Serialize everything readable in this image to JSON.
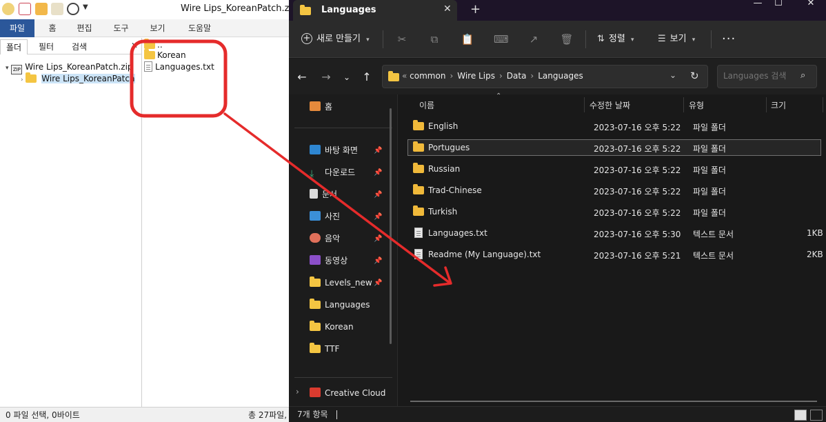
{
  "bandizip": {
    "title": "Wire Lips_KoreanPatch.zip - ",
    "ribbon_tabs": [
      "파일",
      "홈",
      "편집",
      "도구",
      "보기",
      "도움말"
    ],
    "sub_tabs": [
      "폴더",
      "필터",
      "검색"
    ],
    "tree": {
      "archive": "Wire Lips_KoreanPatch.zip",
      "folder": "Wire Lips_KoreanPatch"
    },
    "files": [
      "..",
      "Korean",
      "Languages.txt"
    ],
    "status_left": "0 파일 선택, 0바이트",
    "status_right": "총 27파일,"
  },
  "explorer": {
    "tab_title": "Languages",
    "toolbar": {
      "new_label": "새로 만들기",
      "sort_label": "정렬",
      "view_label": "보기"
    },
    "breadcrumb": [
      "common",
      "Wire Lips",
      "Data",
      "Languages"
    ],
    "search_placeholder": "Languages 검색",
    "nav": {
      "home": "홈",
      "pinned": [
        "바탕 화면",
        "다운로드",
        "문서",
        "사진",
        "음악",
        "동영상",
        "Levels_new"
      ],
      "folders": [
        "Languages",
        "Korean",
        "TTF"
      ],
      "creative_cloud": "Creative Cloud"
    },
    "columns": [
      "이름",
      "수정한 날짜",
      "유형",
      "크기"
    ],
    "rows": [
      {
        "name": "English",
        "date": "2023-07-16 오후 5:22",
        "type": "파일 폴더",
        "size": "",
        "kind": "folder"
      },
      {
        "name": "Portugues",
        "date": "2023-07-16 오후 5:22",
        "type": "파일 폴더",
        "size": "",
        "kind": "folder"
      },
      {
        "name": "Russian",
        "date": "2023-07-16 오후 5:22",
        "type": "파일 폴더",
        "size": "",
        "kind": "folder"
      },
      {
        "name": "Trad-Chinese",
        "date": "2023-07-16 오후 5:22",
        "type": "파일 폴더",
        "size": "",
        "kind": "folder"
      },
      {
        "name": "Turkish",
        "date": "2023-07-16 오후 5:22",
        "type": "파일 폴더",
        "size": "",
        "kind": "folder"
      },
      {
        "name": "Languages.txt",
        "date": "2023-07-16 오후 5:30",
        "type": "텍스트 문서",
        "size": "1KB",
        "kind": "file"
      },
      {
        "name": "Readme (My Language).txt",
        "date": "2023-07-16 오후 5:21",
        "type": "텍스트 문서",
        "size": "2KB",
        "kind": "file"
      }
    ],
    "status": "7개 항목",
    "colors": {
      "accent": "#2b579a",
      "annotation": "#e52b2b",
      "tab_strip": "#1d1428"
    }
  }
}
